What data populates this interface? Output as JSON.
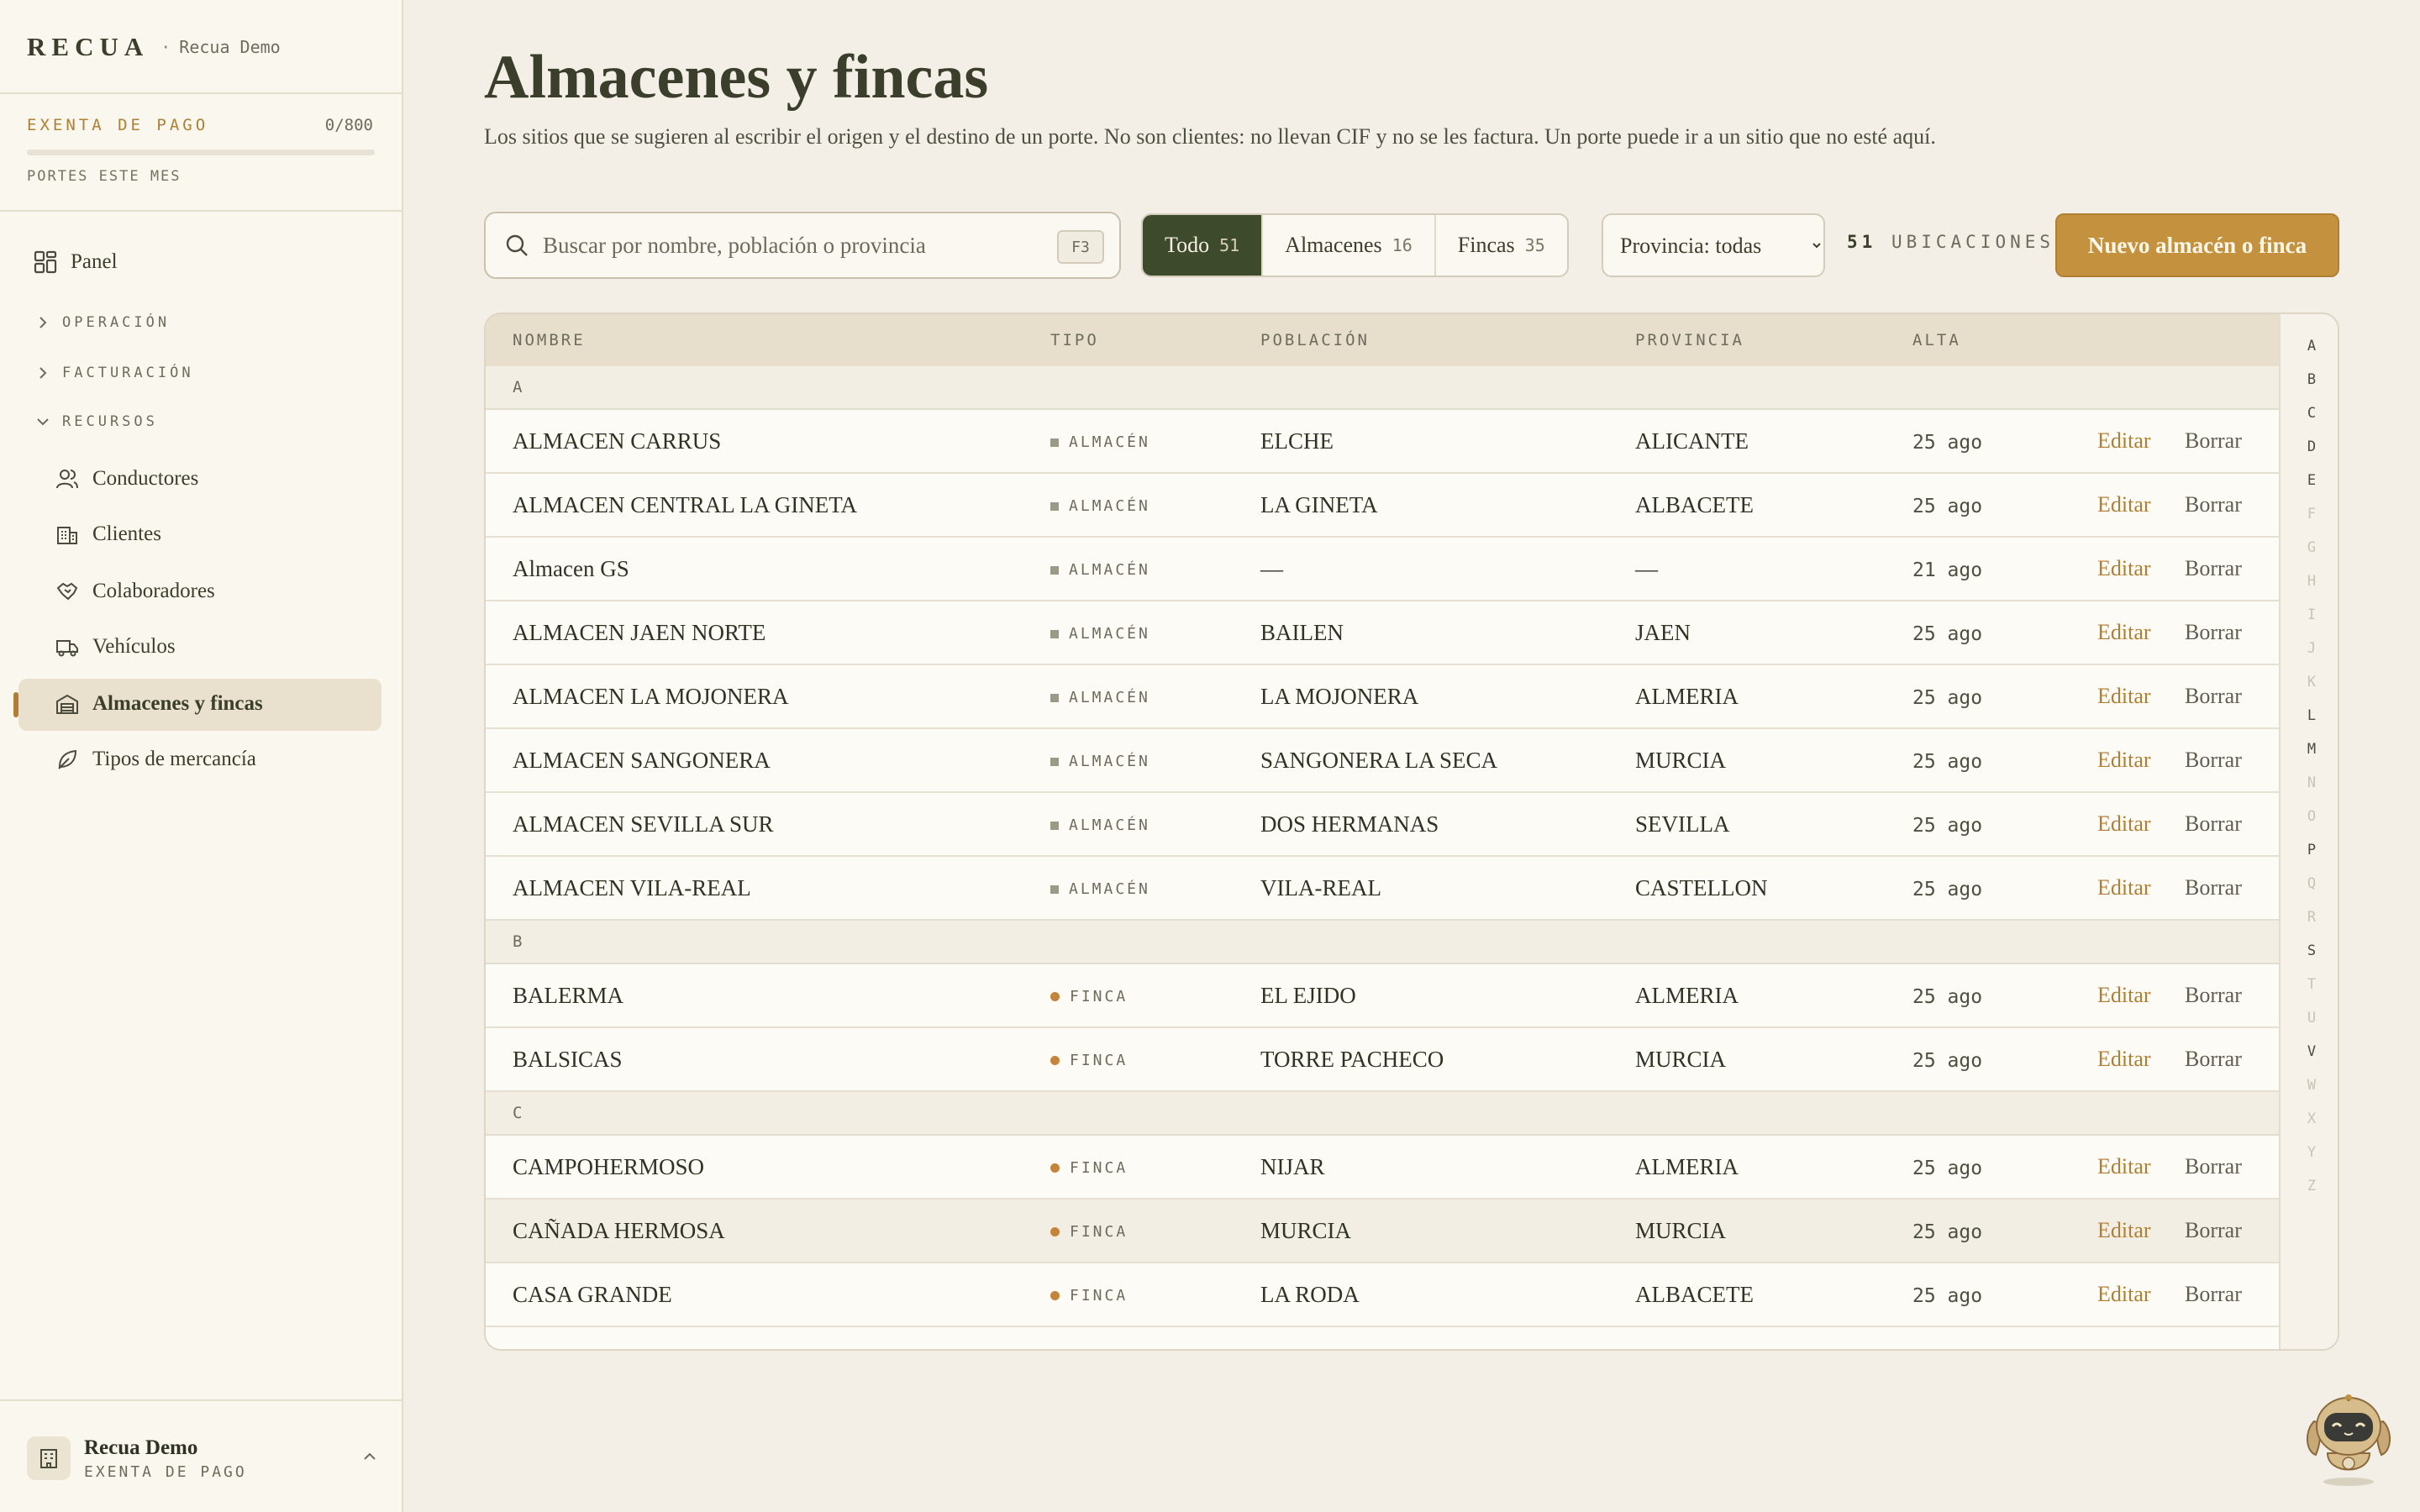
{
  "brand": {
    "logo": "RECUA",
    "separator": "·",
    "workspace": "Recua Demo"
  },
  "plan": {
    "label": "EXENTA DE PAGO",
    "count": "0/800",
    "progress": 0.0,
    "sublabel": "PORTES ESTE MES"
  },
  "nav": {
    "panel": "Panel",
    "sections": {
      "operacion": "OPERACIÓN",
      "facturacion": "FACTURACIÓN",
      "recursos": "RECURSOS"
    },
    "items": {
      "conductores": "Conductores",
      "clientes": "Clientes",
      "colaboradores": "Colaboradores",
      "vehiculos": "Vehículos",
      "almacenes": "Almacenes y fincas",
      "mercancia": "Tipos de mercancía"
    }
  },
  "account": {
    "name": "Recua Demo",
    "plan": "EXENTA DE PAGO"
  },
  "page": {
    "title": "Almacenes y fincas",
    "description": "Los sitios que se sugieren al escribir el origen y el destino de un porte. No son clientes: no llevan CIF y no se les factura. Un porte puede ir a un sitio que no esté aquí."
  },
  "search": {
    "placeholder": "Buscar por nombre, población o provincia",
    "shortcut": "F3"
  },
  "filters": {
    "todo": {
      "label": "Todo",
      "count": "51"
    },
    "almacenes": {
      "label": "Almacenes",
      "count": "16"
    },
    "fincas": {
      "label": "Fincas",
      "count": "35"
    }
  },
  "province_select": {
    "value": "Provincia: todas"
  },
  "total": {
    "count": "51",
    "label": "UBICACIONES"
  },
  "new_button": "Nuevo almacén o finca",
  "table": {
    "headers": {
      "nombre": "NOMBRE",
      "tipo": "TIPO",
      "poblacion": "POBLACIÓN",
      "provincia": "PROVINCIA",
      "alta": "ALTA"
    },
    "actions": {
      "edit": "Editar",
      "delete": "Borrar"
    },
    "groups": [
      {
        "letter": "A",
        "rows": [
          {
            "nombre": "ALMACEN CARRUS",
            "tipo": "ALMACÉN",
            "kind": "almacen",
            "poblacion": "ELCHE",
            "provincia": "ALICANTE",
            "alta": "25 ago"
          },
          {
            "nombre": "ALMACEN CENTRAL LA GINETA",
            "tipo": "ALMACÉN",
            "kind": "almacen",
            "poblacion": "LA GINETA",
            "provincia": "ALBACETE",
            "alta": "25 ago"
          },
          {
            "nombre": "Almacen GS",
            "tipo": "ALMACÉN",
            "kind": "almacen",
            "poblacion": "—",
            "provincia": "—",
            "alta": "21 ago"
          },
          {
            "nombre": "ALMACEN JAEN NORTE",
            "tipo": "ALMACÉN",
            "kind": "almacen",
            "poblacion": "BAILEN",
            "provincia": "JAEN",
            "alta": "25 ago"
          },
          {
            "nombre": "ALMACEN LA MOJONERA",
            "tipo": "ALMACÉN",
            "kind": "almacen",
            "poblacion": "LA MOJONERA",
            "provincia": "ALMERIA",
            "alta": "25 ago"
          },
          {
            "nombre": "ALMACEN SANGONERA",
            "tipo": "ALMACÉN",
            "kind": "almacen",
            "poblacion": "SANGONERA LA SECA",
            "provincia": "MURCIA",
            "alta": "25 ago"
          },
          {
            "nombre": "ALMACEN SEVILLA SUR",
            "tipo": "ALMACÉN",
            "kind": "almacen",
            "poblacion": "DOS HERMANAS",
            "provincia": "SEVILLA",
            "alta": "25 ago"
          },
          {
            "nombre": "ALMACEN VILA-REAL",
            "tipo": "ALMACÉN",
            "kind": "almacen",
            "poblacion": "VILA-REAL",
            "provincia": "CASTELLON",
            "alta": "25 ago"
          }
        ]
      },
      {
        "letter": "B",
        "rows": [
          {
            "nombre": "BALERMA",
            "tipo": "FINCA",
            "kind": "finca",
            "poblacion": "EL EJIDO",
            "provincia": "ALMERIA",
            "alta": "25 ago"
          },
          {
            "nombre": "BALSICAS",
            "tipo": "FINCA",
            "kind": "finca",
            "poblacion": "TORRE PACHECO",
            "provincia": "MURCIA",
            "alta": "25 ago"
          }
        ]
      },
      {
        "letter": "C",
        "rows": [
          {
            "nombre": "CAMPOHERMOSO",
            "tipo": "FINCA",
            "kind": "finca",
            "poblacion": "NIJAR",
            "provincia": "ALMERIA",
            "alta": "25 ago"
          },
          {
            "nombre": "CAÑADA HERMOSA",
            "tipo": "FINCA",
            "kind": "finca",
            "poblacion": "MURCIA",
            "provincia": "MURCIA",
            "alta": "25 ago"
          },
          {
            "nombre": "CASA GRANDE",
            "tipo": "FINCA",
            "kind": "finca",
            "poblacion": "LA RODA",
            "provincia": "ALBACETE",
            "alta": "25 ago"
          }
        ]
      }
    ]
  },
  "alphabet": {
    "letters": [
      "A",
      "B",
      "C",
      "D",
      "E",
      "F",
      "G",
      "H",
      "I",
      "J",
      "K",
      "L",
      "M",
      "N",
      "O",
      "P",
      "Q",
      "R",
      "S",
      "T",
      "U",
      "V",
      "W",
      "X",
      "Y",
      "Z"
    ],
    "available": [
      "A",
      "B",
      "C",
      "D",
      "E",
      "L",
      "M",
      "P",
      "S",
      "V"
    ]
  },
  "colors": {
    "accent": "#b07f34",
    "primary_dark": "#3e4a2c",
    "background": "#f3efe6",
    "sidebar": "#faf7ef"
  }
}
